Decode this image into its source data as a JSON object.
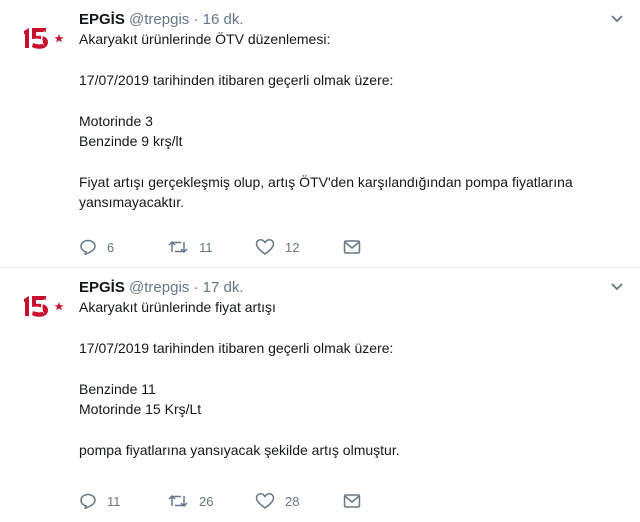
{
  "tweets": [
    {
      "name": "EPGİS",
      "handle": "@trepgis",
      "dot": "·",
      "time": "16 dk.",
      "lines": [
        "Akaryakıt  ürünlerinde ÖTV düzenlemesi:",
        "",
        "17/07/2019 tarihinden itibaren geçerli olmak üzere:",
        "",
        "Motorinde  3",
        "Benzinde 9 krş/lt",
        "",
        "Fiyat artışı gerçekleşmiş olup, artış ÖTV'den karşılandığından pompa fiyatlarına",
        "yansımayacaktır."
      ],
      "replies": "6",
      "retweets": "11",
      "likes": "12"
    },
    {
      "name": "EPGİS",
      "handle": "@trepgis",
      "dot": "·",
      "time": "17 dk.",
      "lines": [
        "Akaryakıt  ürünlerinde fiyat artışı",
        "",
        "17/07/2019 tarihinden itibaren geçerli olmak üzere:",
        "",
        "Benzinde 11",
        "Motorinde 15 Krş/Lt",
        "",
        "pompa fiyatlarına yansıyacak şekilde artış olmuştur."
      ],
      "replies": "11",
      "retweets": "26",
      "likes": "28"
    }
  ],
  "icons": {
    "avatar": "logo-15-star-icon",
    "menu": "chevron-down-icon",
    "reply": "reply-icon",
    "retweet": "retweet-icon",
    "like": "heart-icon",
    "dm": "envelope-icon"
  },
  "colors": {
    "logo": "#c8102e",
    "muted": "#657786",
    "text": "#14171a",
    "divider": "#e6ecf0"
  }
}
